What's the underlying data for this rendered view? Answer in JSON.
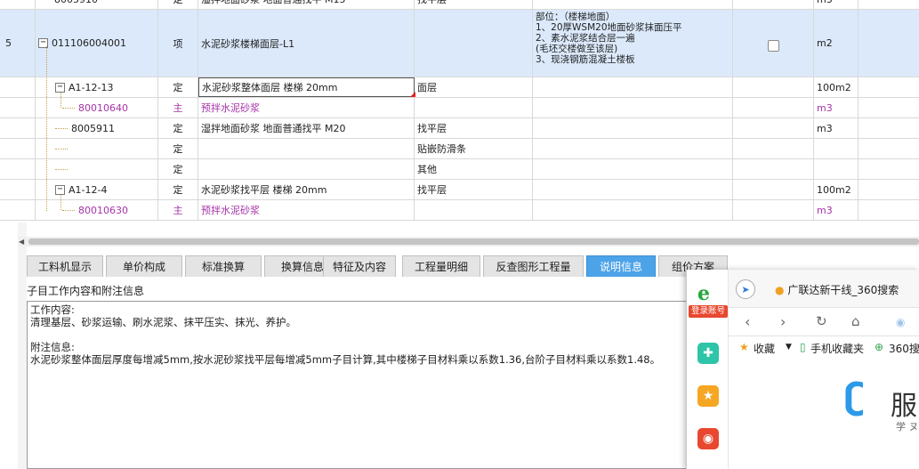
{
  "grid": {
    "rows": [
      {
        "no": "",
        "code": "8005910",
        "type": "定",
        "name": "湿拌地面砂浆 地面普通找平 M15",
        "feature": "找平层",
        "content": "",
        "unit": "m3"
      },
      {
        "no": "5",
        "code": "011106004001",
        "type": "项",
        "name": "水泥砂浆楼梯面层-L1",
        "feature": "",
        "content_lines": [
          "部位：（楼梯地面）",
          "1、20厚WSM20地面砂浆抹面压平",
          "2、素水泥浆结合层一遍",
          "(毛坯交楼做至该层)",
          "3、现浇钢筋混凝土楼板"
        ],
        "unit": "m2"
      },
      {
        "code": "A1-12-13",
        "type": "定",
        "name": "水泥砂浆整体面层 楼梯 20mm",
        "feature": "面层",
        "unit": "100m2"
      },
      {
        "code": "80010640",
        "type": "主",
        "name": "预拌水泥砂浆",
        "feature": "",
        "unit": "m3"
      },
      {
        "code": "8005911",
        "type": "定",
        "name": "湿拌地面砂浆 地面普通找平 M20",
        "feature": "找平层",
        "unit": "m3"
      },
      {
        "code": "",
        "type": "定",
        "name": "",
        "feature": "贴嵌防滑条",
        "unit": ""
      },
      {
        "code": "",
        "type": "定",
        "name": "",
        "feature": "其他",
        "unit": ""
      },
      {
        "code": "A1-12-4",
        "type": "定",
        "name": "水泥砂浆找平层 楼梯 20mm",
        "feature": "找平层",
        "unit": "100m2"
      },
      {
        "code": "80010630",
        "type": "主",
        "name": "预拌水泥砂浆",
        "feature": "",
        "unit": "m3"
      }
    ]
  },
  "tabs": [
    "工料机显示",
    "单价构成",
    "标准换算",
    "换算信息",
    "特征及内容",
    "工程量明细",
    "反查图形工程量",
    "说明信息",
    "组价方案"
  ],
  "info": {
    "header": "子目工作内容和附注信息",
    "lines": [
      "工作内容:",
      "清理基层、砂浆运输、刷水泥浆、抹平压实、抹光、养护。",
      "",
      "附注信息:",
      "水泥砂浆整体面层厚度每增减5mm,按水泥砂浆找平层每增减5mm子目计算,其中楼梯子目材料乘以系数1.36,台阶子目材料乘以系数1.48。"
    ]
  },
  "popup": {
    "login": "登录账号",
    "tab_title": "广联达新干线_360搜索",
    "bookmarks": [
      "收藏",
      "手机收藏夹",
      "360搜"
    ],
    "logo_char": "服",
    "logo_sub": "学 ヌ"
  },
  "colors": {
    "selected_row": "#dbe9fb",
    "main_material": "#a633a8",
    "active_tab": "#4da3e8"
  }
}
